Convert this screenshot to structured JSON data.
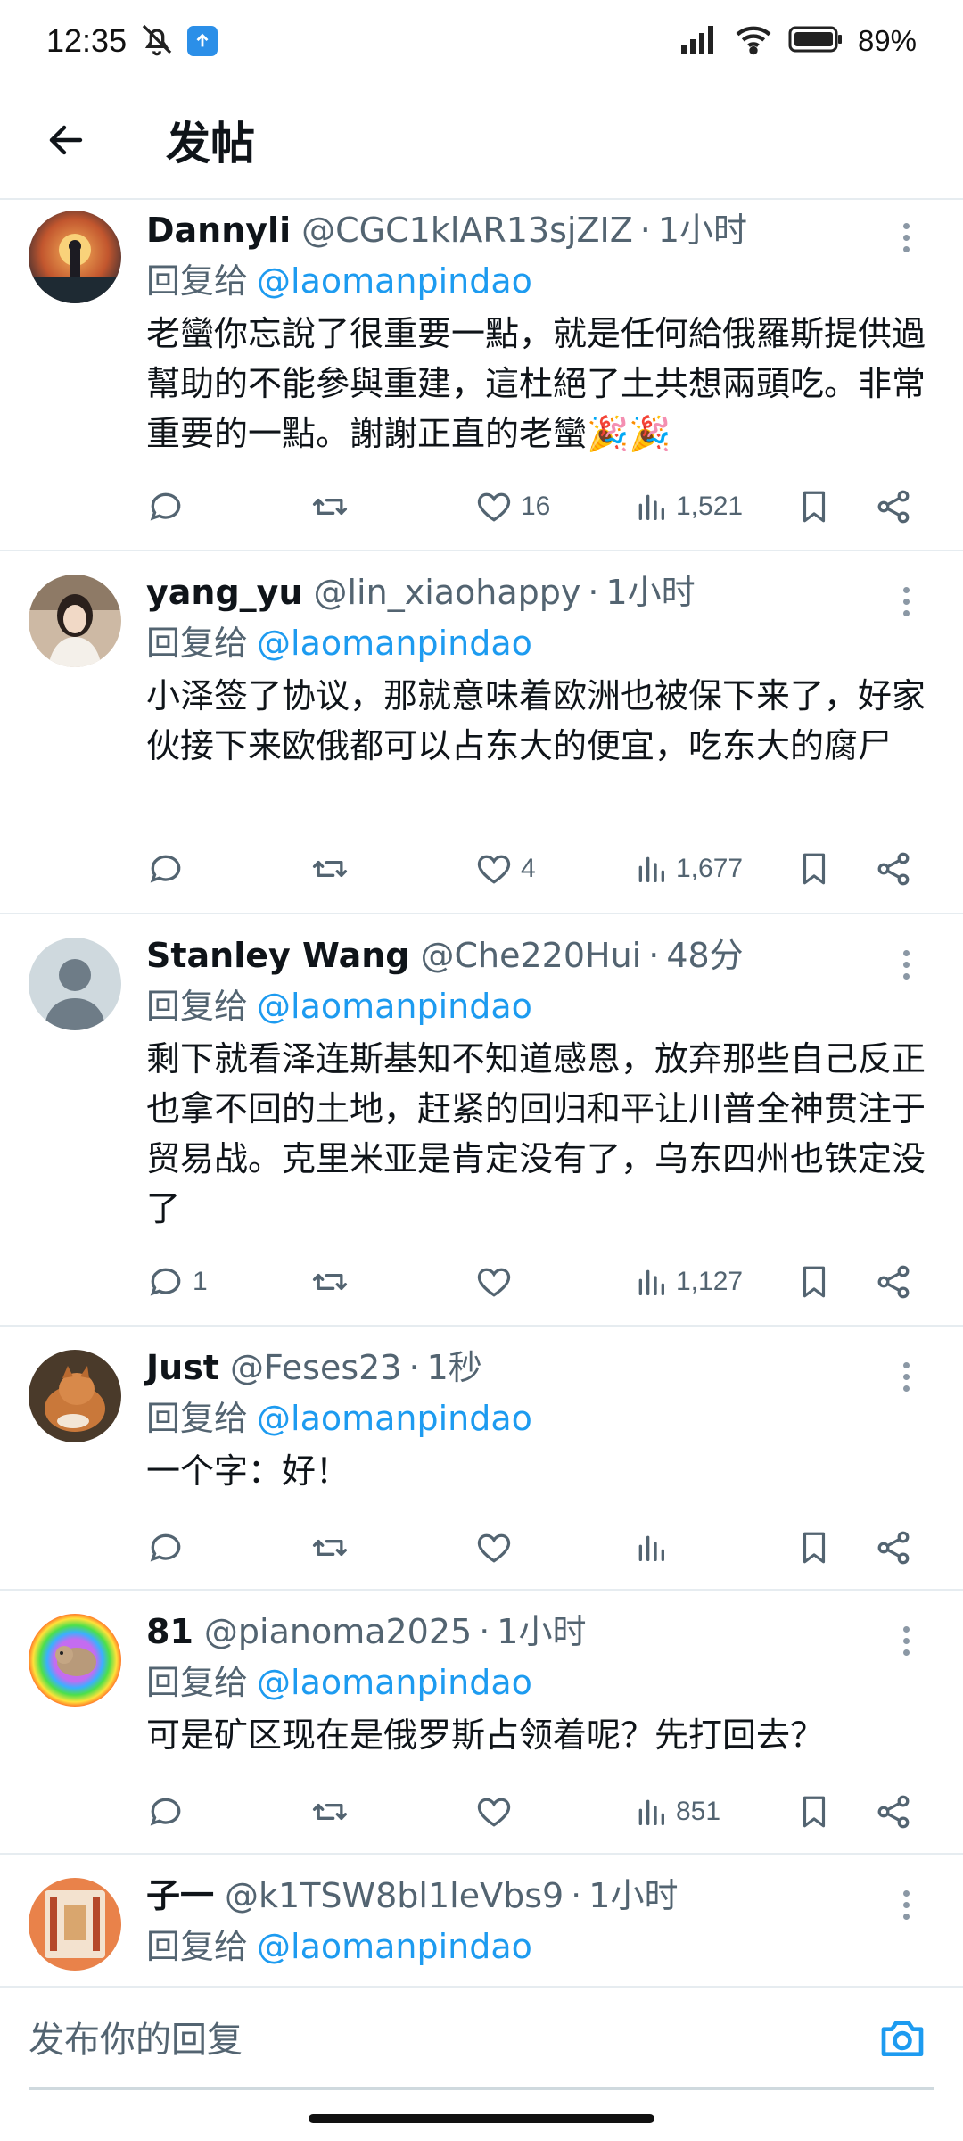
{
  "status_bar": {
    "time": "12:35",
    "battery": "89%",
    "icons": [
      "mute-icon",
      "upload-notification-icon",
      "signal-icon",
      "wifi-icon",
      "battery-icon"
    ]
  },
  "header": {
    "title": "发帖",
    "back_icon": "arrow-left-icon"
  },
  "tweets": [
    {
      "name": "Dannyli",
      "handle": "@CGC1klAR13sjZIZ",
      "dot": "·",
      "time": "1小时",
      "reply_prefix": "回复给",
      "reply_to": "@laomanpindao",
      "text": "老蠻你忘說了很重要一點，就是任何給俄羅斯提供過幫助的不能參與重建，這杜絕了土共想兩頭吃。非常重要的一點。謝謝正直的老蠻🎉🎉",
      "replies": "",
      "retweets": "",
      "likes": "16",
      "views": "1,521"
    },
    {
      "name": "yang_yu",
      "handle": "@lin_xiaohappy",
      "dot": "·",
      "time": "1小时",
      "reply_prefix": "回复给",
      "reply_to": "@laomanpindao",
      "text": "小泽签了协议，那就意味着欧洲也被保下来了，好家伙接下来欧俄都可以占东大的便宜，吃东大的腐尸",
      "replies": "",
      "retweets": "",
      "likes": "4",
      "views": "1,677"
    },
    {
      "name": "Stanley Wang",
      "handle": "@Che220Hui",
      "dot": "·",
      "time": "48分",
      "reply_prefix": "回复给",
      "reply_to": "@laomanpindao",
      "text": "剩下就看泽连斯基知不知道感恩，放弃那些自己反正也拿不回的土地，赶紧的回归和平让川普全神贯注于贸易战。克里米亚是肯定没有了，乌东四州也铁定没了",
      "replies": "1",
      "retweets": "",
      "likes": "",
      "views": "1,127"
    },
    {
      "name": "Just",
      "handle": "@Feses23",
      "dot": "·",
      "time": "1秒",
      "reply_prefix": "回复给",
      "reply_to": "@laomanpindao",
      "text": "一个字：好！",
      "replies": "",
      "retweets": "",
      "likes": "",
      "views": ""
    },
    {
      "name": "81",
      "handle": "@pianoma2025",
      "dot": "·",
      "time": "1小时",
      "reply_prefix": "回复给",
      "reply_to": "@laomanpindao",
      "text": "可是矿区现在是俄罗斯占领着呢？先打回去？",
      "replies": "",
      "retweets": "",
      "likes": "",
      "views": "851"
    },
    {
      "name": "子一",
      "handle": "@k1TSW8bl1leVbs9",
      "dot": "·",
      "time": "1小时",
      "reply_prefix": "回复给",
      "reply_to": "@laomanpindao",
      "text": "",
      "replies": "",
      "retweets": "",
      "likes": "",
      "views": ""
    }
  ],
  "reply_bar": {
    "placeholder": "发布你的回复",
    "camera_icon": "camera-icon"
  },
  "colors": {
    "accent": "#1d9bf0",
    "secondary_text": "#536471",
    "divider": "#e6ecf0"
  }
}
